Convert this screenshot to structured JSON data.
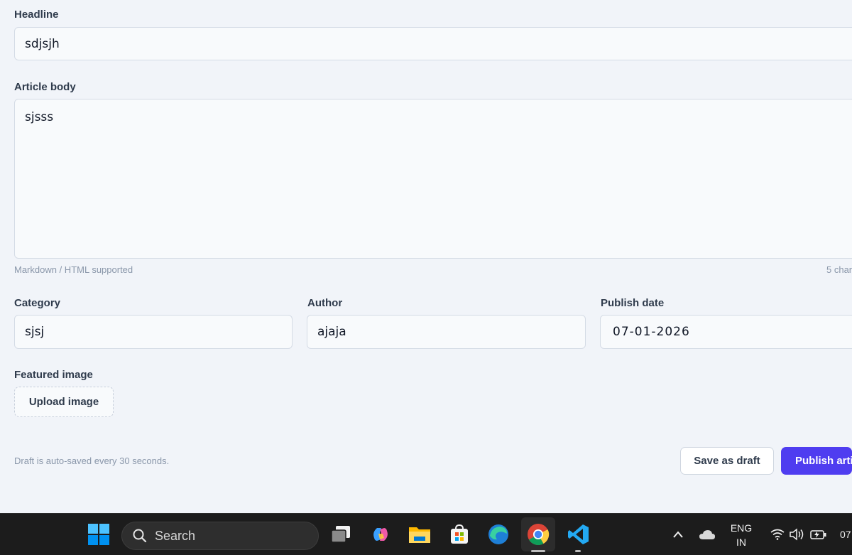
{
  "form": {
    "headline": {
      "label": "Headline",
      "value": "sdjsjh"
    },
    "body": {
      "label": "Article body",
      "value": "sjsss",
      "hint": "Markdown / HTML supported",
      "counter": "5 char"
    },
    "category": {
      "label": "Category",
      "value": "sjsj"
    },
    "author": {
      "label": "Author",
      "value": "ajaja"
    },
    "publish_date": {
      "label": "Publish date",
      "value": "07-01-2026"
    },
    "featured_image": {
      "label": "Featured image",
      "button": "Upload image"
    },
    "footer": {
      "note": "Draft is auto-saved every 30 seconds.",
      "save_draft": "Save as draft",
      "publish": "Publish artic"
    }
  },
  "taskbar": {
    "search_placeholder": "Search",
    "lang_top": "ENG",
    "lang_bottom": "IN",
    "clock_partial": "07",
    "pinned": [
      "task-view",
      "copilot",
      "file-explorer",
      "microsoft-store",
      "edge",
      "chrome",
      "vscode"
    ],
    "colors": {
      "accent": "#4f3df0",
      "taskbar": "#1c1c1c"
    }
  }
}
